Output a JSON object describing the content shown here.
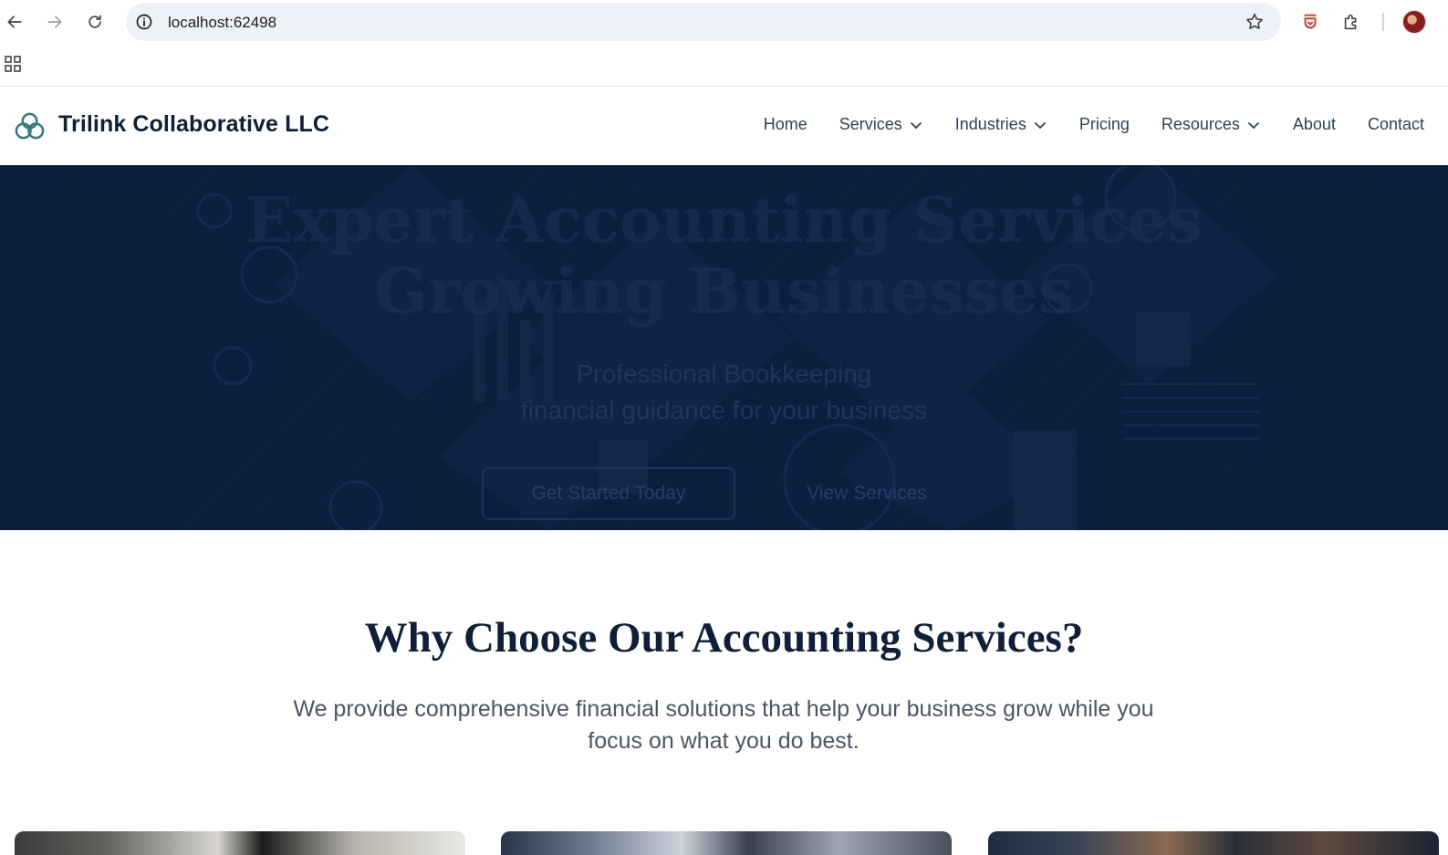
{
  "browser": {
    "url": "localhost:62498"
  },
  "site": {
    "brand": "Trilink Collaborative LLC",
    "nav": [
      {
        "label": "Home",
        "has_dropdown": false
      },
      {
        "label": "Services",
        "has_dropdown": true
      },
      {
        "label": "Industries",
        "has_dropdown": true
      },
      {
        "label": "Pricing",
        "has_dropdown": false
      },
      {
        "label": "Resources",
        "has_dropdown": true
      },
      {
        "label": "About",
        "has_dropdown": false
      },
      {
        "label": "Contact",
        "has_dropdown": false
      }
    ]
  },
  "hero": {
    "title_line1": "Expert Accounting Services",
    "title_line2": "Growing Businesses",
    "subtitle_line1": "Professional Bookkeeping",
    "subtitle_line2": "financial guidance for your business",
    "primary_button": "Get Started Today",
    "secondary_button": "View Services"
  },
  "why": {
    "title": "Why Choose Our Accounting Services?",
    "subtitle": "We provide comprehensive financial solutions that help your business grow while you focus on what you do best."
  },
  "colors": {
    "navy": "#0c1f3f",
    "brand_text": "#0f1f3a",
    "logo_teal": "#2e7d7a"
  }
}
